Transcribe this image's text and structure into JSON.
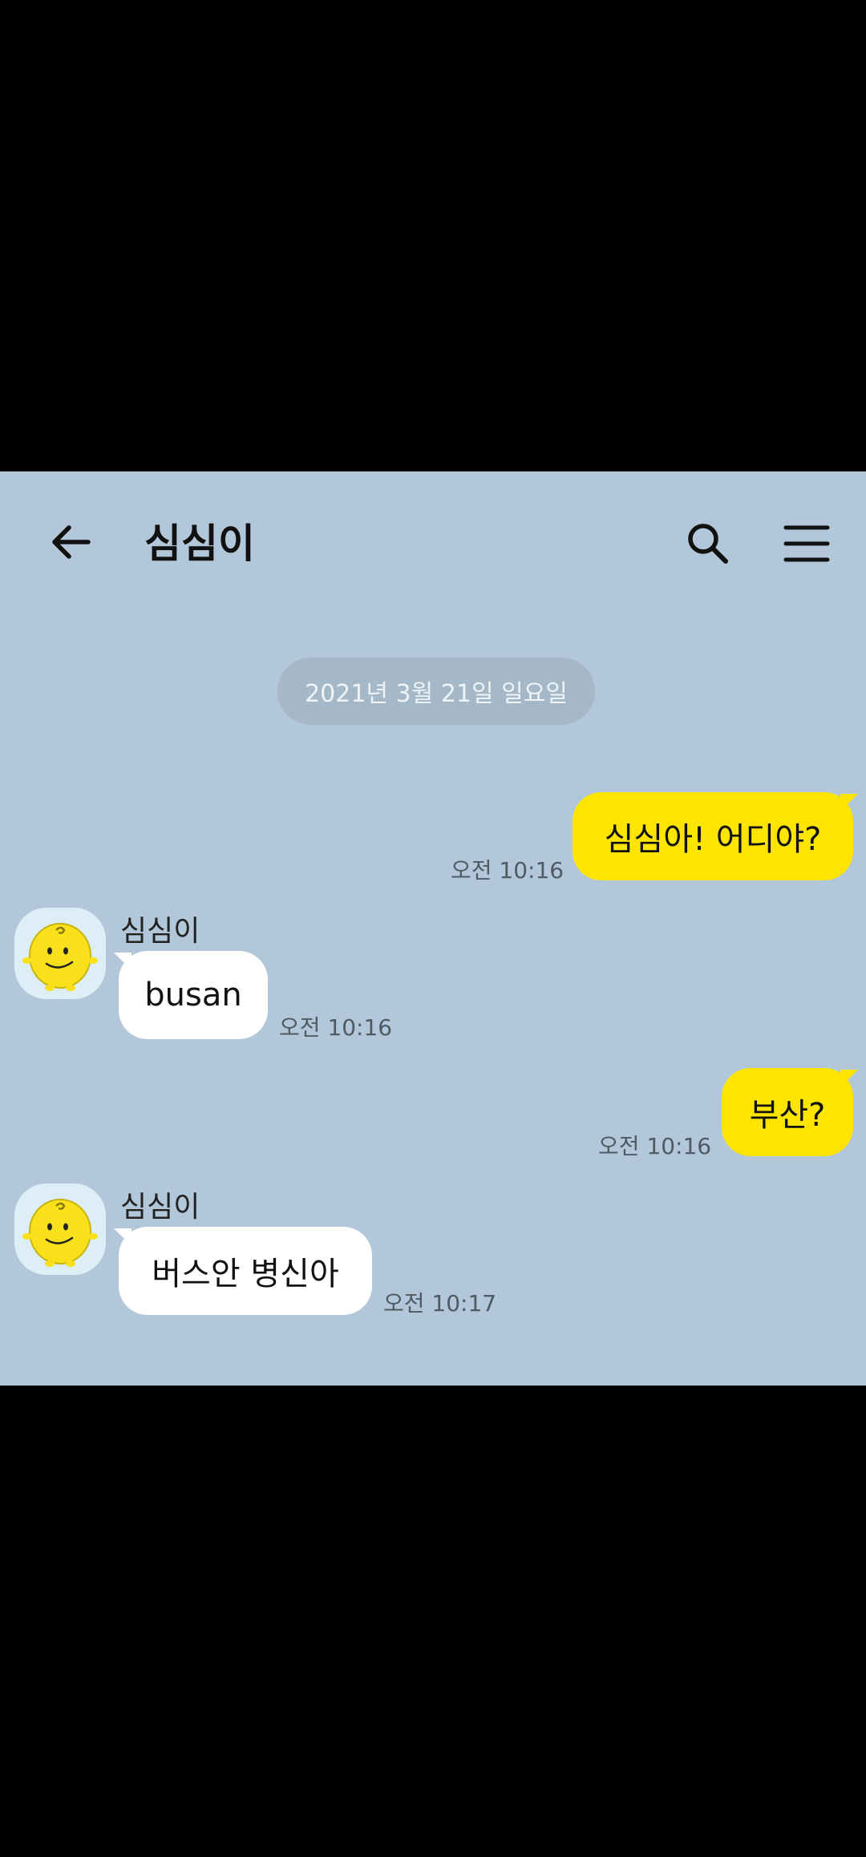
{
  "header": {
    "title": "심심이",
    "back_icon": "arrow-left-icon",
    "search_icon": "search-icon",
    "menu_icon": "hamburger-menu-icon"
  },
  "date_divider": "2021년 3월 21일 일요일",
  "messages": [
    {
      "from": "me",
      "text": "심심아! 어디야?",
      "time": "오전 10:16"
    },
    {
      "from": "other",
      "sender": "심심이",
      "text": "busan",
      "time": "오전 10:16"
    },
    {
      "from": "me",
      "text": "부산?",
      "time": "오전 10:16"
    },
    {
      "from": "other",
      "sender": "심심이",
      "text": "버스안 병신아",
      "time": "오전 10:17"
    }
  ],
  "colors": {
    "chat_background": "#b2c7da",
    "my_bubble": "#fee500",
    "other_bubble": "#ffffff",
    "frame": "#000000"
  }
}
